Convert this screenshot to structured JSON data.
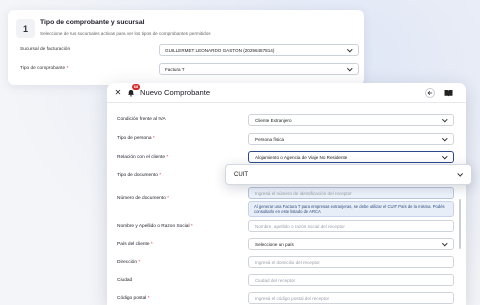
{
  "step_card": {
    "step_number": "1",
    "title": "Tipo de comprobante y sucursal",
    "subtitle": "Seleccione de tus sucursales activas para ver los tipos de comprobantes permitidos",
    "branch_label": "Sucursal de facturación",
    "branch_value": "GUILLERMET LEONARDO GASTON (20296487814)",
    "voucher_type_label": "Tipo de comprobante",
    "voucher_type_value": "Factura T"
  },
  "modal": {
    "title": "Nuevo Comprobante",
    "notification_count": "68",
    "fields": {
      "iva_condition": {
        "label": "Condición frente al IVA",
        "value": "Cliente Extranjero"
      },
      "person_type": {
        "label": "Tipo de persona",
        "value": "Persona física"
      },
      "client_relation": {
        "label": "Relación con el cliente",
        "value": "Alojamiento o Agencia de Viaje No Residente"
      },
      "document_type": {
        "label": "Tipo de documento"
      },
      "document_number": {
        "label": "Número de documento",
        "placeholder": "Ingresá el número de identificación del receptor",
        "note": "Al generar una Factura T para empresas extranjeras, se debe utilizar el CUIT País de la misma. Podés consultarlo en este listado de ARCA"
      },
      "name": {
        "label": "Nombre y Apellido o Razon Social",
        "placeholder": "Nombre, apellido o razón social del receptor"
      },
      "country": {
        "label": "País del cliente",
        "value": "Seleccione un país"
      },
      "address": {
        "label": "Dirección",
        "placeholder": "Ingresá el domicilio del receptor"
      },
      "city": {
        "label": "Ciudad",
        "placeholder": "Ciudad del receptor"
      },
      "postal_code": {
        "label": "Código postal",
        "placeholder": "Ingresá el código postal del receptor"
      }
    }
  },
  "overlay_select": {
    "value": "CUIT"
  },
  "colors": {
    "required": "#e03030",
    "active_border": "#2b4a8c",
    "note_bg": "#e8eef8",
    "badge": "#d62828"
  },
  "icons": [
    "close-icon",
    "bell-icon",
    "arrow-left-icon",
    "book-icon",
    "chevron-down-icon"
  ]
}
